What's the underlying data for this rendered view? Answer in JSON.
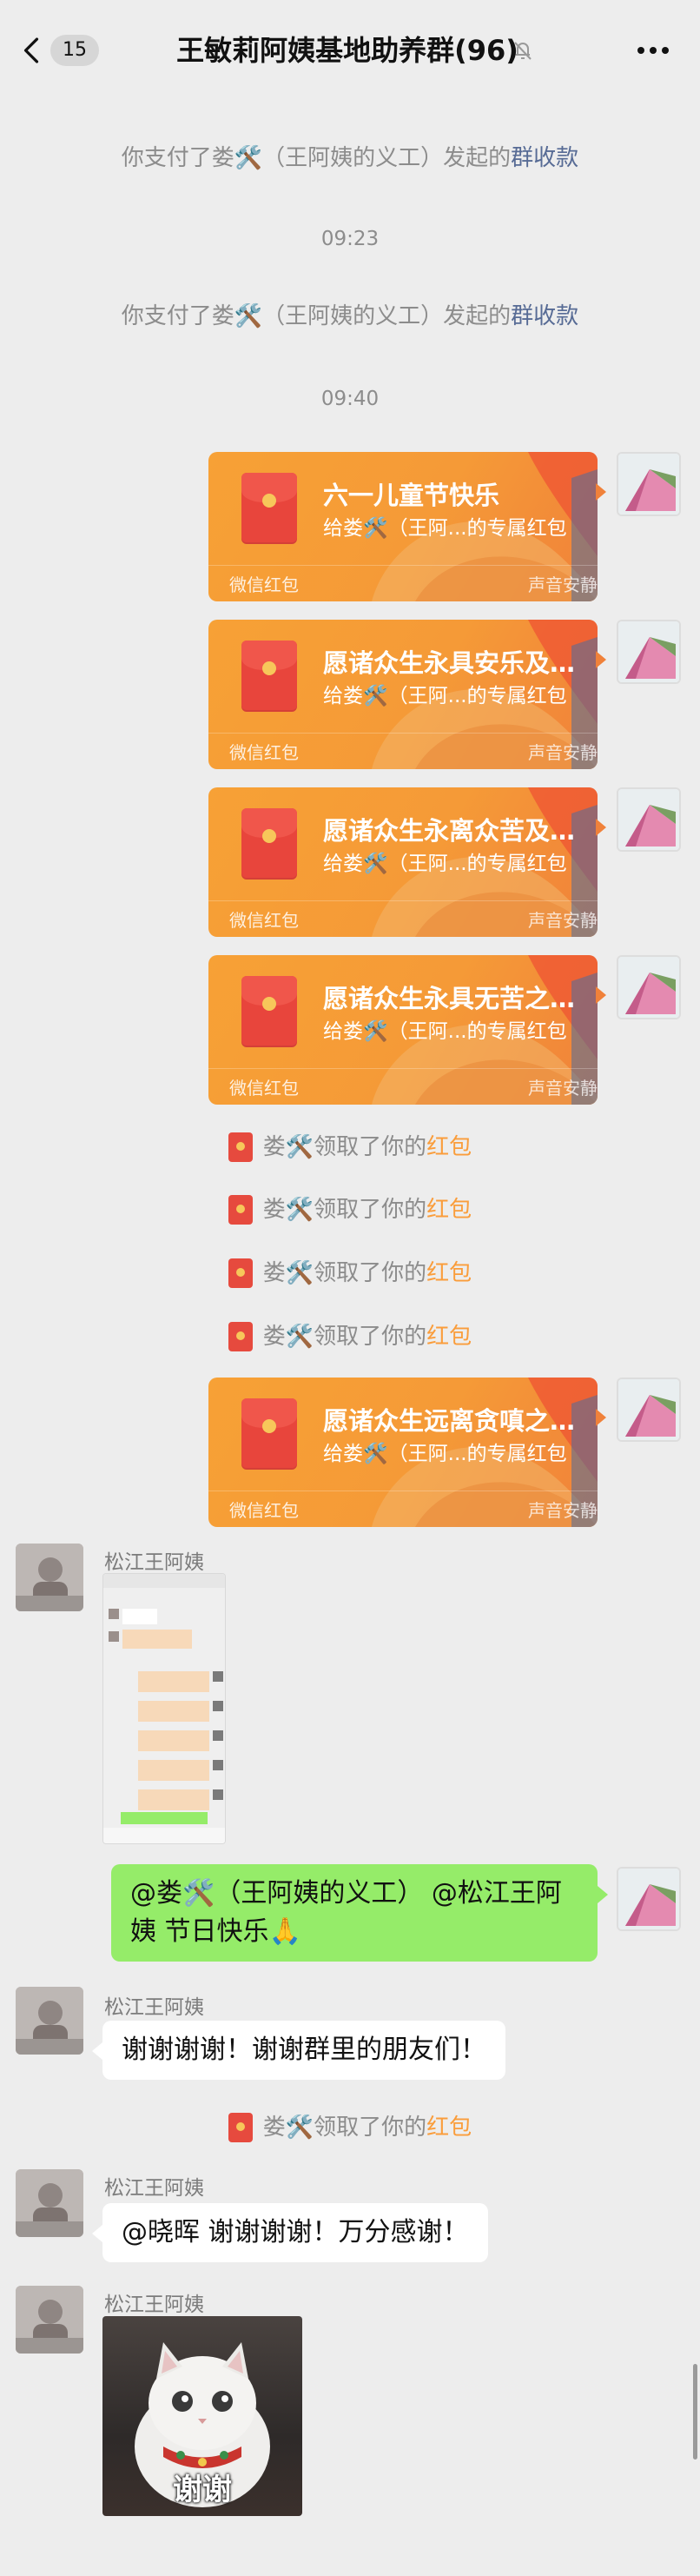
{
  "header": {
    "unread_count": "15",
    "title": "王敏莉阿姨基地助养群(96)"
  },
  "system": {
    "paid_prefix": "你支付了娄🛠️（王阿姨的义工）发起的",
    "paid_link": "群收款",
    "time1": "09:23",
    "time2": "09:40"
  },
  "packets": [
    {
      "title": "六一儿童节快乐",
      "subtitle": "给娄🛠️（王阿...的专属红包",
      "label": "微信红包",
      "brand": "声音安静"
    },
    {
      "title": "愿诸众生永具安乐及…",
      "subtitle": "给娄🛠️（王阿...的专属红包",
      "label": "微信红包",
      "brand": "声音安静"
    },
    {
      "title": "愿诸众生永离众苦及…",
      "subtitle": "给娄🛠️（王阿...的专属红包",
      "label": "微信红包",
      "brand": "声音安静"
    },
    {
      "title": "愿诸众生永具无苦之…",
      "subtitle": "给娄🛠️（王阿...的专属红包",
      "label": "微信红包",
      "brand": "声音安静"
    },
    {
      "title": "愿诸众生远离贪嗔之…",
      "subtitle": "给娄🛠️（王阿...的专属红包",
      "label": "微信红包",
      "brand": "声音安静"
    }
  ],
  "notice": {
    "prefix": "娄🛠️领取了你的",
    "link": "红包"
  },
  "sender_name": "松江王阿姨",
  "messages": {
    "my_green": "@娄🛠️（王阿姨的义工） @松江王阿姨  节日快乐🙏",
    "thanks1": "谢谢谢谢！谢谢群里的朋友们！",
    "thanks2": "@晓晖  谢谢谢谢！万分感谢！",
    "sticker_text": "谢谢"
  },
  "icons": {
    "back": "chevron-left-icon",
    "mute": "mute-bell-icon",
    "more": "more-dots-icon"
  }
}
